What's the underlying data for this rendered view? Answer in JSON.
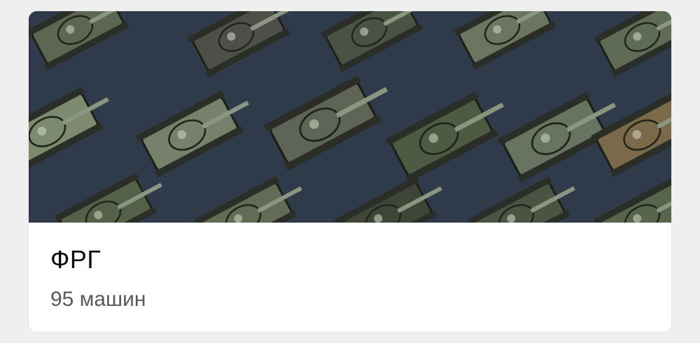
{
  "card": {
    "title": "ФРГ",
    "subtitle": "95 машин",
    "image_subject": "tank-grid-illustration"
  },
  "colors": {
    "page_background": "#efefef",
    "card_background": "#ffffff",
    "banner_background": "#2f3a4b",
    "title_color": "#0d0d0d",
    "subtitle_color": "#5a5a5a"
  }
}
